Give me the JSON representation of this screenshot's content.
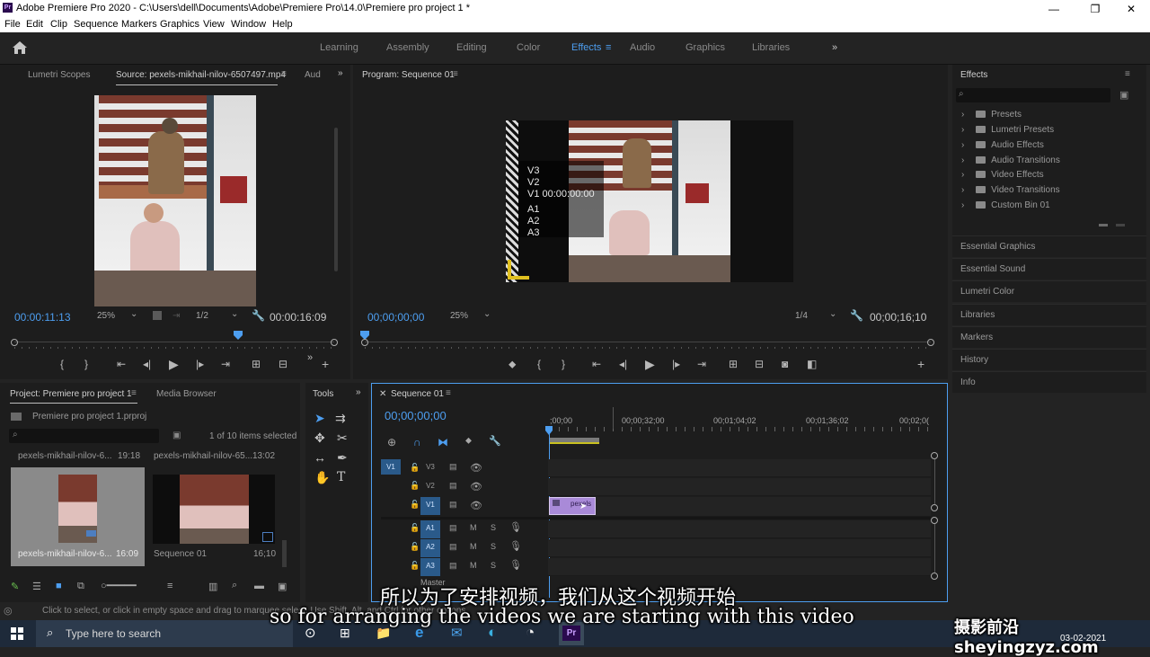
{
  "window": {
    "title": "Adobe Premiere Pro 2020 - C:\\Users\\dell\\Documents\\Adobe\\Premiere Pro\\14.0\\Premiere pro project 1 *",
    "app_icon": "Pr",
    "minimize": "—",
    "maximize": "❐",
    "close": "✕"
  },
  "menu": [
    "File",
    "Edit",
    "Clip",
    "Sequence",
    "Markers",
    "Graphics",
    "View",
    "Window",
    "Help"
  ],
  "workspaces": {
    "items": [
      "Learning",
      "Assembly",
      "Editing",
      "Color",
      "Effects",
      "Audio",
      "Graphics",
      "Libraries"
    ],
    "active": "Effects",
    "more": "»"
  },
  "source": {
    "tab_scopes": "Lumetri Scopes",
    "tab_source": "Source: pexels-mikhail-nilov-6507497.mp4",
    "tab_aud": "Aud",
    "timecode": "00:00:11:13",
    "zoom": "25%",
    "resolution": "1/2",
    "duration": "00:00:16:09",
    "playhead_fraction": 0.7
  },
  "program": {
    "tab": "Program: Sequence 01",
    "timecode": "00;00;00;00",
    "zoom": "25%",
    "resolution": "1/4",
    "duration": "00;00;16;10",
    "overlay_lines": [
      "V3",
      "V2",
      "V1 00:00:00:00",
      "A1",
      "A2",
      "A3"
    ]
  },
  "effects": {
    "title": "Effects",
    "search_placeholder": "",
    "folders": [
      "Presets",
      "Lumetri Presets",
      "Audio Effects",
      "Audio Transitions",
      "Video Effects",
      "Video Transitions",
      "Custom Bin 01"
    ],
    "side_panels": [
      "Essential Graphics",
      "Essential Sound",
      "Lumetri Color",
      "Libraries",
      "Markers",
      "History",
      "Info"
    ]
  },
  "project": {
    "tab": "Project: Premiere pro project 1",
    "tab_browser": "Media Browser",
    "file": "Premiere pro project 1.prproj",
    "selection": "1 of 10 items selected",
    "bin_top": [
      {
        "name": "pexels-mikhail-nilov-6...",
        "dur": "19:18"
      },
      {
        "name": "pexels-mikhail-nilov-65...",
        "dur": "13:02"
      }
    ],
    "items": [
      {
        "name": "pexels-mikhail-nilov-6...",
        "dur": "16:09"
      },
      {
        "name": "Sequence 01",
        "dur": "16;10"
      }
    ]
  },
  "tools": {
    "tab": "Tools"
  },
  "timeline": {
    "tab": "Sequence 01",
    "timecode": "00;00;00;00",
    "ruler": [
      ";00;00",
      "00;00;32;00",
      "00;01;04;02",
      "00;01;36;02",
      "00;02;0("
    ],
    "tracks_v": [
      "V3",
      "V2",
      "V1"
    ],
    "tracks_a": [
      "A1",
      "A2",
      "A3"
    ],
    "src_patch": "V1",
    "clip_label": "pexels",
    "mute": "M",
    "solo": "S",
    "master_partial": "Master"
  },
  "status": {
    "hint": "Click to select, or click in empty space and drag to marquee select. Use Shift, Alt, and Ctrl for other options."
  },
  "subtitles": {
    "zh": "所以为了安排视频，我们从这个视频开始",
    "en": "so for arranging the videos we are starting with this video",
    "watermark": "摄影前沿 sheyingzyz.com"
  },
  "taskbar": {
    "search_placeholder": "Type here to search",
    "date": "03-02-2021",
    "apps": [
      "⊙",
      "⊞",
      "📁",
      "e",
      "✉",
      "◐",
      "◔",
      "Pr"
    ]
  },
  "colors": {
    "accent": "#4d9ef0",
    "clip": "#a98ad8",
    "panel": "#1d1d1d"
  }
}
